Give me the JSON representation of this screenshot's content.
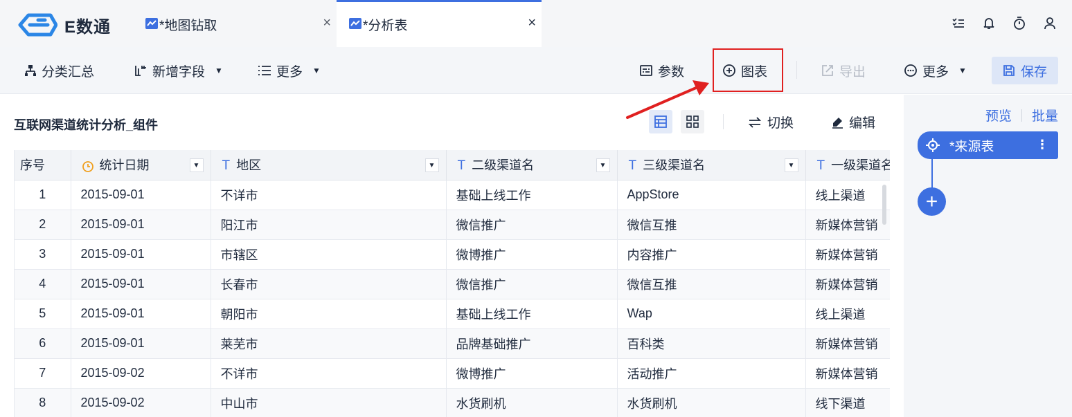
{
  "app": {
    "logo_text": "E数通",
    "brand_color": "#3d6fe0"
  },
  "tabs": [
    {
      "label": "*地图钻取",
      "close": "×",
      "active": false
    },
    {
      "label": "*分析表",
      "close": "×",
      "active": true
    }
  ],
  "top_icons": [
    "list-icon",
    "bell-icon",
    "timer-icon",
    "user-icon"
  ],
  "toolbar": {
    "group_summary": "分类汇总",
    "add_field": "新增字段",
    "more_left": "更多",
    "params": "参数",
    "chart": "图表",
    "export": "导出",
    "more_right": "更多",
    "save": "保存"
  },
  "sheet": {
    "title": "互联网渠道统计分析_组件",
    "switch_label": "切换",
    "edit_label": "编辑",
    "columns": [
      {
        "label": "序号"
      },
      {
        "label": "统计日期",
        "type": "date"
      },
      {
        "label": "地区",
        "type": "text"
      },
      {
        "label": "二级渠道名",
        "type": "text"
      },
      {
        "label": "三级渠道名",
        "type": "text"
      },
      {
        "label": "一级渠道名",
        "type": "text"
      }
    ],
    "rows": [
      [
        "1",
        "2015-09-01",
        "不详市",
        "基础上线工作",
        "AppStore",
        "线上渠道"
      ],
      [
        "2",
        "2015-09-01",
        "阳江市",
        "微信推广",
        "微信互推",
        "新媒体营销"
      ],
      [
        "3",
        "2015-09-01",
        "市辖区",
        "微博推广",
        "内容推广",
        "新媒体营销"
      ],
      [
        "4",
        "2015-09-01",
        "长春市",
        "微信推广",
        "微信互推",
        "新媒体营销"
      ],
      [
        "5",
        "2015-09-01",
        "朝阳市",
        "基础上线工作",
        "Wap",
        "线上渠道"
      ],
      [
        "6",
        "2015-09-01",
        "莱芜市",
        "品牌基础推广",
        "百科类",
        "新媒体营销"
      ],
      [
        "7",
        "2015-09-02",
        "不详市",
        "微博推广",
        "活动推广",
        "新媒体营销"
      ],
      [
        "8",
        "2015-09-02",
        "中山市",
        "水货刷机",
        "水货刷机",
        "线下渠道"
      ]
    ]
  },
  "right_panel": {
    "preview": "预览",
    "batch": "批量",
    "source_node": "*来源表",
    "kebab": "⋮",
    "add": "+"
  }
}
